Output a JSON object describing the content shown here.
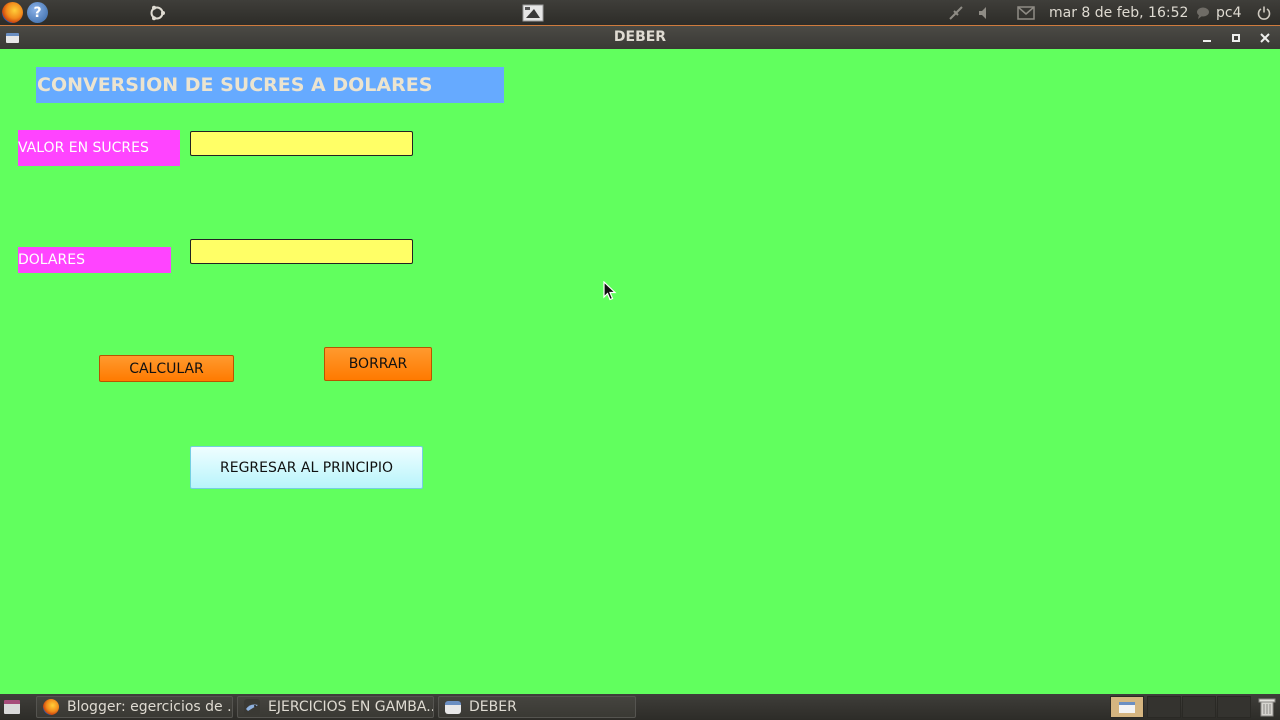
{
  "top_panel": {
    "clock": "mar  8 de feb, 16:52",
    "user": "pc4",
    "icons": [
      "firefox-icon",
      "help-icon",
      "ubuntu-icon",
      "screenshot-icon",
      "network-icon",
      "volume-icon",
      "mail-icon",
      "chat-icon",
      "power-icon"
    ]
  },
  "window": {
    "title": "DEBER",
    "controls": [
      "minimize-icon",
      "maximize-icon",
      "close-icon"
    ]
  },
  "app": {
    "heading": "CONVERSION DE SUCRES A DOLARES",
    "sucres_label": "VALOR EN SUCRES",
    "sucres_value": "",
    "dolares_label": "DOLARES",
    "dolares_value": "",
    "calcular_label": "CALCULAR",
    "borrar_label": "BORRAR",
    "regresar_label": "REGRESAR AL PRINCIPIO"
  },
  "taskbar": {
    "tasks": [
      {
        "label": "Blogger: egercicios de ...",
        "icon": "firefox-icon"
      },
      {
        "label": "EJERCICIOS EN GAMBA...",
        "icon": "gambas-icon"
      },
      {
        "label": "DEBER",
        "icon": "window-icon"
      }
    ],
    "workspaces": 4
  },
  "colors": {
    "background": "#61ff5e",
    "heading_bg": "#66aaff",
    "label_bg": "#ff44ff",
    "input_bg": "#ffff66",
    "button_orange": "#ff8c1a",
    "button_cyan": "#c8f7fc"
  }
}
